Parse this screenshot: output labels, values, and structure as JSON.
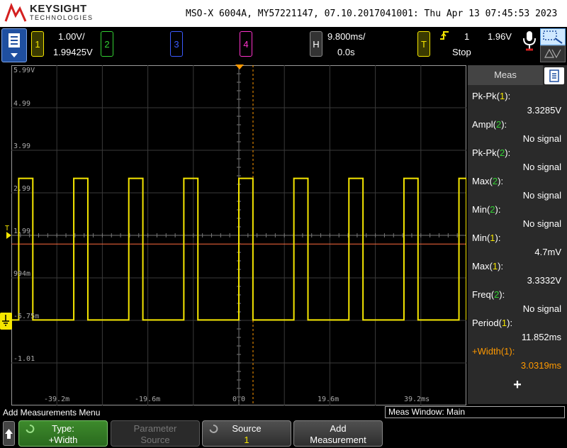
{
  "header": {
    "brand": "KEYSIGHT",
    "brand_sub": "TECHNOLOGIES",
    "info": "MSO-X 6004A, MY57221147, 07.10.2017041001: Thu Apr 13 07:45:53 2023"
  },
  "channels": {
    "ch1": {
      "number": "1",
      "scale": "1.00V/",
      "offset": "1.99425V",
      "color": "#f5e600"
    },
    "ch2": {
      "number": "2",
      "color": "#33d133"
    },
    "ch3": {
      "number": "3",
      "color": "#3b5bff"
    },
    "ch4": {
      "number": "4",
      "color": "#ff33cc"
    }
  },
  "horizontal": {
    "label": "H",
    "timebase": "9.800ms/",
    "delay": "0.0s"
  },
  "trigger": {
    "label": "T",
    "source": "1",
    "level": "1.96V",
    "status": "Stop"
  },
  "graticule": {
    "volt_labels": [
      "5.99V",
      "4.99",
      "3.99",
      "2.99",
      "1.99",
      "994m",
      "-5.75m",
      "-1.01"
    ],
    "time_labels": [
      "-39.2m",
      "-19.6m",
      "0.0",
      "19.6m",
      "39.2ms"
    ],
    "trigger_marker": "T",
    "ground_marker": "1"
  },
  "waveform": {
    "period_ms": 11.852,
    "pulse_width_ms": 3.0319,
    "high_v": 3.3332,
    "low_v": 0.0047
  },
  "meas_panel": {
    "title": "Meas",
    "items": [
      {
        "name": "Pk-Pk(",
        "ch": "1",
        "value": "3.3285V"
      },
      {
        "name": "Ampl(",
        "ch": "2",
        "value": "No signal"
      },
      {
        "name": "Pk-Pk(",
        "ch": "2",
        "value": "No signal"
      },
      {
        "name": "Max(",
        "ch": "2",
        "value": "No signal"
      },
      {
        "name": "Min(",
        "ch": "2",
        "value": "No signal"
      },
      {
        "name": "Min(",
        "ch": "1",
        "value": "4.7mV"
      },
      {
        "name": "Max(",
        "ch": "1",
        "value": "3.3332V"
      },
      {
        "name": "Freq(",
        "ch": "2",
        "value": "No signal"
      },
      {
        "name": "Period(",
        "ch": "1",
        "value": "11.852ms"
      },
      {
        "name": "+Width(",
        "ch": "1",
        "value": "3.0319ms"
      }
    ],
    "add_symbol": "+"
  },
  "bottom": {
    "menu_title": "Add Measurements Menu",
    "meas_window": "Meas Window: Main",
    "softkeys": [
      {
        "line1": "Type:",
        "line2": "+Width"
      },
      {
        "line1": "Parameter",
        "line2": "Source"
      },
      {
        "line1": "Source",
        "line2": "1"
      },
      {
        "line1": "Add",
        "line2": "Measurement"
      }
    ]
  }
}
